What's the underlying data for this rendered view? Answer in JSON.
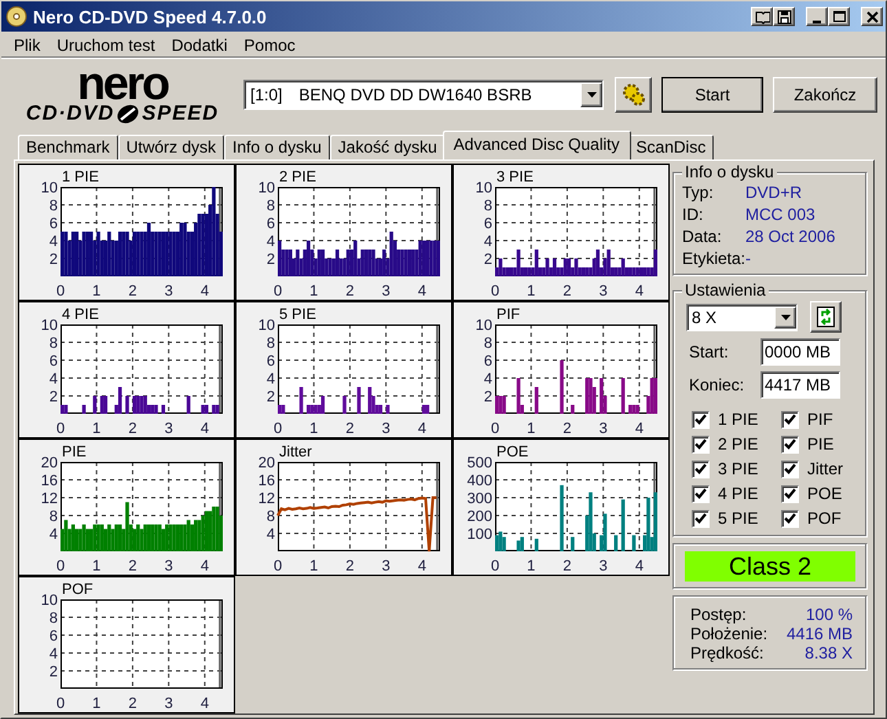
{
  "window": {
    "title": "Nero CD-DVD Speed 4.7.0.0"
  },
  "menu": [
    "Plik",
    "Uruchom test",
    "Dodatki",
    "Pomoc"
  ],
  "logo": {
    "top": "nero",
    "left": "CD·DVD",
    "right": "SPEED"
  },
  "toolbar": {
    "drive_id": "[1:0]",
    "drive_name": "BENQ DVD DD DW1640 BSRB",
    "buttons": [
      "Start",
      "Zakończ"
    ]
  },
  "tabs": [
    {
      "label": "Benchmark",
      "selected": false
    },
    {
      "label": "Utwórz dysk",
      "selected": false
    },
    {
      "label": "Info o dysku",
      "selected": false
    },
    {
      "label": "Jakość dysku",
      "selected": false
    },
    {
      "label": "Advanced Disc Quality",
      "selected": true
    },
    {
      "label": "ScanDisc",
      "selected": false
    }
  ],
  "charts": [
    {
      "title": "1 PIE",
      "chart_data": {
        "grid": true,
        "ref_lines": [
          {
            "axis": "x",
            "value": 4.42,
            "color": "#606060"
          }
        ],
        "type": "bar",
        "xlim": [
          0,
          4.5
        ],
        "ylim": [
          0,
          10
        ],
        "xticks": [
          0,
          1,
          2,
          3,
          4
        ],
        "yticks": [
          2,
          4,
          6,
          8,
          10
        ],
        "x": [
          0,
          0.1,
          0.2,
          0.3,
          0.4,
          0.5,
          0.6,
          0.7,
          0.8,
          0.9,
          1,
          1.1,
          1.2,
          1.3,
          1.4,
          1.5,
          1.6,
          1.7,
          1.8,
          1.9,
          2,
          2.1,
          2.2,
          2.3,
          2.4,
          2.5,
          2.6,
          2.7,
          2.8,
          2.9,
          3,
          3.1,
          3.2,
          3.3,
          3.4,
          3.5,
          3.6,
          3.7,
          3.8,
          3.9,
          4,
          4.1,
          4.2,
          4.3,
          4.4
        ],
        "series": [
          {
            "color": "#10087c",
            "values": [
              5,
              5,
              4,
              5,
              5,
              4,
              5,
              5,
              5,
              4,
              5,
              4,
              4,
              5,
              4,
              4,
              5,
              5,
              5,
              4,
              5,
              5,
              5,
              5,
              6,
              5,
              5,
              5,
              5,
              5,
              5,
              5,
              5,
              6,
              6,
              5,
              5,
              6,
              7,
              7,
              7,
              8,
              10,
              7,
              5
            ]
          }
        ]
      }
    },
    {
      "title": "2 PIE",
      "chart_data": {
        "grid": true,
        "ref_lines": [
          {
            "axis": "x",
            "value": 4.42,
            "color": "#606060"
          }
        ],
        "type": "bar",
        "xlim": [
          0,
          4.5
        ],
        "ylim": [
          0,
          10
        ],
        "xticks": [
          0,
          1,
          2,
          3,
          4
        ],
        "yticks": [
          2,
          4,
          6,
          8,
          10
        ],
        "x": [
          0,
          0.1,
          0.2,
          0.3,
          0.4,
          0.5,
          0.6,
          0.7,
          0.8,
          0.9,
          1,
          1.1,
          1.2,
          1.3,
          1.4,
          1.5,
          1.6,
          1.7,
          1.8,
          1.9,
          2,
          2.1,
          2.2,
          2.3,
          2.4,
          2.5,
          2.6,
          2.7,
          2.8,
          2.9,
          3,
          3.1,
          3.2,
          3.3,
          3.4,
          3.5,
          3.6,
          3.7,
          3.8,
          3.9,
          4,
          4.1,
          4.2,
          4.3,
          4.4
        ],
        "series": [
          {
            "color": "#280a88",
            "values": [
              4,
              3,
              3,
              3,
              2,
              3,
              2,
              3,
              4,
              3,
              2,
              3,
              3,
              2,
              2,
              2,
              3,
              2,
              2,
              3,
              3,
              4,
              2,
              3,
              3,
              3,
              3,
              2,
              2,
              3,
              2,
              5,
              4,
              3,
              3,
              3,
              3,
              3,
              3,
              4,
              4,
              4,
              4,
              4,
              4
            ]
          }
        ]
      }
    },
    {
      "title": "3 PIE",
      "chart_data": {
        "grid": true,
        "ref_lines": [
          {
            "axis": "x",
            "value": 4.42,
            "color": "#606060"
          }
        ],
        "type": "bar",
        "xlim": [
          0,
          4.5
        ],
        "ylim": [
          0,
          10
        ],
        "xticks": [
          0,
          1,
          2,
          3,
          4
        ],
        "yticks": [
          2,
          4,
          6,
          8,
          10
        ],
        "x": [
          0,
          0.1,
          0.2,
          0.3,
          0.4,
          0.5,
          0.6,
          0.7,
          0.8,
          0.9,
          1,
          1.1,
          1.2,
          1.3,
          1.4,
          1.5,
          1.6,
          1.7,
          1.8,
          1.9,
          2,
          2.1,
          2.2,
          2.3,
          2.4,
          2.5,
          2.6,
          2.7,
          2.8,
          2.9,
          3,
          3.1,
          3.2,
          3.3,
          3.4,
          3.5,
          3.6,
          3.7,
          3.8,
          3.9,
          4,
          4.1,
          4.2,
          4.3,
          4.4
        ],
        "series": [
          {
            "color": "#38088e",
            "values": [
              1,
              2,
              1,
              1,
              1,
              1,
              3,
              1,
              1,
              1,
              1,
              3,
              1,
              1,
              2,
              1,
              2,
              1,
              1,
              2,
              2,
              1,
              2,
              1,
              1,
              1,
              1,
              2,
              3,
              1,
              2,
              3,
              1,
              1,
              1,
              2,
              1,
              1,
              1,
              1,
              1,
              1,
              1,
              1,
              3
            ]
          }
        ]
      }
    },
    {
      "title": "4 PIE",
      "chart_data": {
        "grid": true,
        "ref_lines": [
          {
            "axis": "x",
            "value": 4.42,
            "color": "#606060"
          }
        ],
        "type": "bar",
        "xlim": [
          0,
          4.5
        ],
        "ylim": [
          0,
          10
        ],
        "xticks": [
          0,
          1,
          2,
          3,
          4
        ],
        "yticks": [
          2,
          4,
          6,
          8,
          10
        ],
        "x": [
          0,
          0.1,
          0.6,
          0.9,
          1.1,
          1.2,
          1.5,
          1.6,
          1.8,
          2,
          2.1,
          2.2,
          2.3,
          2.4,
          2.5,
          2.6,
          2.8,
          3.5,
          3.9,
          4,
          4.2,
          4.3
        ],
        "series": [
          {
            "color": "#4a0896",
            "values": [
              1,
              1,
              1,
              2,
              2,
              2,
              1,
              3,
              2,
              2,
              2,
              2,
              2,
              1,
              1,
              1,
              1,
              2,
              1,
              1,
              1,
              1
            ]
          }
        ]
      }
    },
    {
      "title": "5 PIE",
      "chart_data": {
        "grid": true,
        "ref_lines": [
          {
            "axis": "x",
            "value": 4.42,
            "color": "#606060"
          }
        ],
        "type": "bar",
        "xlim": [
          0,
          4.5
        ],
        "ylim": [
          0,
          10
        ],
        "xticks": [
          0,
          1,
          2,
          3,
          4
        ],
        "yticks": [
          2,
          4,
          6,
          8,
          10
        ],
        "x": [
          0,
          0.1,
          0.6,
          0.8,
          0.9,
          1,
          1.1,
          1.2,
          1.8,
          2.2,
          2.5,
          2.6,
          2.7,
          2.8,
          3,
          4,
          4.1
        ],
        "series": [
          {
            "color": "#600c9c",
            "values": [
              1,
              1,
              3,
              1,
              1,
              1,
              1,
              2,
              2,
              3,
              3,
              2,
              1,
              1,
              1,
              1,
              1
            ]
          }
        ]
      }
    },
    {
      "title": "PIF",
      "chart_data": {
        "grid": true,
        "ref_lines": [
          {
            "axis": "x",
            "value": 4.42,
            "color": "#606060"
          }
        ],
        "type": "bar",
        "xlim": [
          0,
          4.5
        ],
        "ylim": [
          0,
          10
        ],
        "xticks": [
          0,
          1,
          2,
          3,
          4
        ],
        "yticks": [
          2,
          4,
          6,
          8,
          10
        ],
        "x": [
          0,
          0.1,
          0.2,
          0.6,
          0.7,
          1.1,
          1.8,
          2.1,
          2.5,
          2.6,
          2.7,
          2.9,
          3,
          3.5,
          3.7,
          3.8,
          3.9,
          4.2,
          4.3,
          4.4
        ],
        "series": [
          {
            "color": "#880a88",
            "values": [
              2,
              2,
              2,
              4,
              1,
              3,
              6,
              1,
              4,
              4,
              3,
              4,
              2,
              4,
              1,
              1,
              1,
              2,
              4,
              4
            ]
          }
        ]
      }
    },
    {
      "title": "PIE",
      "chart_data": {
        "grid": true,
        "ref_lines": [
          {
            "axis": "x",
            "value": 4.42,
            "color": "#606060"
          }
        ],
        "type": "bar",
        "xlim": [
          0,
          4.5
        ],
        "ylim": [
          0,
          20
        ],
        "xticks": [
          0,
          1,
          2,
          3,
          4
        ],
        "yticks": [
          4,
          8,
          12,
          16,
          20
        ],
        "x": [
          0,
          0.1,
          0.2,
          0.3,
          0.4,
          0.5,
          0.6,
          0.7,
          0.8,
          0.9,
          1,
          1.1,
          1.2,
          1.3,
          1.4,
          1.5,
          1.6,
          1.7,
          1.8,
          1.9,
          2,
          2.1,
          2.2,
          2.3,
          2.4,
          2.5,
          2.6,
          2.7,
          2.8,
          2.9,
          3,
          3.1,
          3.2,
          3.3,
          3.4,
          3.5,
          3.6,
          3.7,
          3.8,
          3.9,
          4,
          4.1,
          4.2,
          4.3,
          4.4
        ],
        "series": [
          {
            "color": "#008000",
            "values": [
              5,
              7,
              5,
              6,
              5,
              5,
              6,
              5,
              5,
              6,
              6,
              6,
              5,
              6,
              5,
              6,
              6,
              5,
              11,
              6,
              5,
              6,
              5,
              6,
              6,
              6,
              6,
              6,
              5,
              6,
              6,
              6,
              6,
              6,
              6,
              7,
              6,
              7,
              7,
              8,
              9,
              9,
              10,
              10,
              8
            ]
          }
        ]
      }
    },
    {
      "title": "Jitter",
      "chart_data": {
        "grid": true,
        "ref_lines": [
          {
            "axis": "x",
            "value": 4.42,
            "color": "#606060"
          }
        ],
        "type": "line",
        "xlim": [
          0,
          4.5
        ],
        "ylim": [
          0,
          20
        ],
        "xticks": [
          0,
          1,
          2,
          3,
          4
        ],
        "yticks": [
          4,
          8,
          12,
          16,
          20
        ],
        "x": [
          0,
          0.1,
          0.2,
          0.3,
          0.4,
          0.5,
          0.6,
          0.7,
          0.8,
          0.9,
          1,
          1.1,
          1.2,
          1.3,
          1.4,
          1.5,
          1.6,
          1.7,
          1.8,
          1.9,
          2,
          2.1,
          2.2,
          2.3,
          2.4,
          2.5,
          2.6,
          2.7,
          2.8,
          2.9,
          3,
          3.1,
          3.2,
          3.3,
          3.4,
          3.5,
          3.6,
          3.7,
          3.8,
          3.9,
          4,
          4.1,
          4.2,
          4.3,
          4.4
        ],
        "series": [
          {
            "color": "#b04000",
            "values": [
              8,
              9.5,
              9.3,
              9.6,
              9.4,
              9.5,
              9.7,
              9.5,
              9.6,
              9.8,
              9.6,
              9.7,
              9.8,
              9.9,
              9.7,
              10,
              10.1,
              10,
              10.3,
              10.4,
              10.6,
              10.5,
              10.7,
              10.8,
              10.9,
              11,
              10.8,
              11,
              11.1,
              11,
              11.3,
              11.2,
              11.3,
              11.4,
              11.5,
              11.4,
              11.6,
              11.7,
              11.5,
              11.8,
              11.9,
              11.8,
              0,
              12,
              12
            ]
          }
        ]
      }
    },
    {
      "title": "POE",
      "chart_data": {
        "grid": true,
        "ref_lines": [
          {
            "axis": "x",
            "value": 4.42,
            "color": "#606060"
          }
        ],
        "type": "bar",
        "xlim": [
          0,
          4.5
        ],
        "ylim": [
          0,
          500
        ],
        "xticks": [
          0,
          1,
          2,
          3,
          4
        ],
        "yticks": [
          100,
          200,
          300,
          400,
          500
        ],
        "x": [
          0,
          0.1,
          0.2,
          0.6,
          0.7,
          1.1,
          1.8,
          2.1,
          2.5,
          2.6,
          2.7,
          2.9,
          3,
          3.3,
          3.5,
          3.8,
          4.1,
          4.2,
          4.3,
          4.4
        ],
        "series": [
          {
            "color": "#008080",
            "values": [
              90,
              110,
              80,
              60,
              80,
              70,
              370,
              80,
              200,
              330,
              100,
              90,
              210,
              90,
              290,
              90,
              90,
              300,
              80,
              330
            ]
          }
        ]
      }
    },
    {
      "title": "POF",
      "chart_data": {
        "grid": true,
        "ref_lines": [
          {
            "axis": "x",
            "value": 4.42,
            "color": "#606060"
          }
        ],
        "type": "bar",
        "xlim": [
          0,
          4.5
        ],
        "ylim": [
          0,
          10
        ],
        "xticks": [
          0,
          1,
          2,
          3,
          4
        ],
        "yticks": [
          2,
          4,
          6,
          8,
          10
        ]
      }
    }
  ],
  "disc_info": {
    "title": "Info o dysku",
    "fields": [
      {
        "label": "Typ:",
        "value": "DVD+R"
      },
      {
        "label": "ID:",
        "value": "MCC 003"
      },
      {
        "label": "Data:",
        "value": "28 Oct 2006"
      },
      {
        "label": "Etykieta:",
        "value": "-"
      }
    ]
  },
  "settings": {
    "title": "Ustawienia",
    "speed": "8 X",
    "start_label": "Start:",
    "start": "0000 MB",
    "end_label": "Koniec:",
    "end": "4417 MB",
    "checks": [
      {
        "label": "1 PIE",
        "checked": true
      },
      {
        "label": "PIF",
        "checked": true
      },
      {
        "label": "2 PIE",
        "checked": true
      },
      {
        "label": "PIE",
        "checked": true
      },
      {
        "label": "3 PIE",
        "checked": true
      },
      {
        "label": "Jitter",
        "checked": true
      },
      {
        "label": "4 PIE",
        "checked": true
      },
      {
        "label": "POE",
        "checked": true
      },
      {
        "label": "5 PIE",
        "checked": true
      },
      {
        "label": "POF",
        "checked": true
      }
    ]
  },
  "result": {
    "label": "Class 2"
  },
  "stats": [
    {
      "label": "Postęp:",
      "value": "100 %"
    },
    {
      "label": "Położenie:",
      "value": "4416 MB"
    },
    {
      "label": "Prędkość:",
      "value": "8.38 X"
    }
  ]
}
